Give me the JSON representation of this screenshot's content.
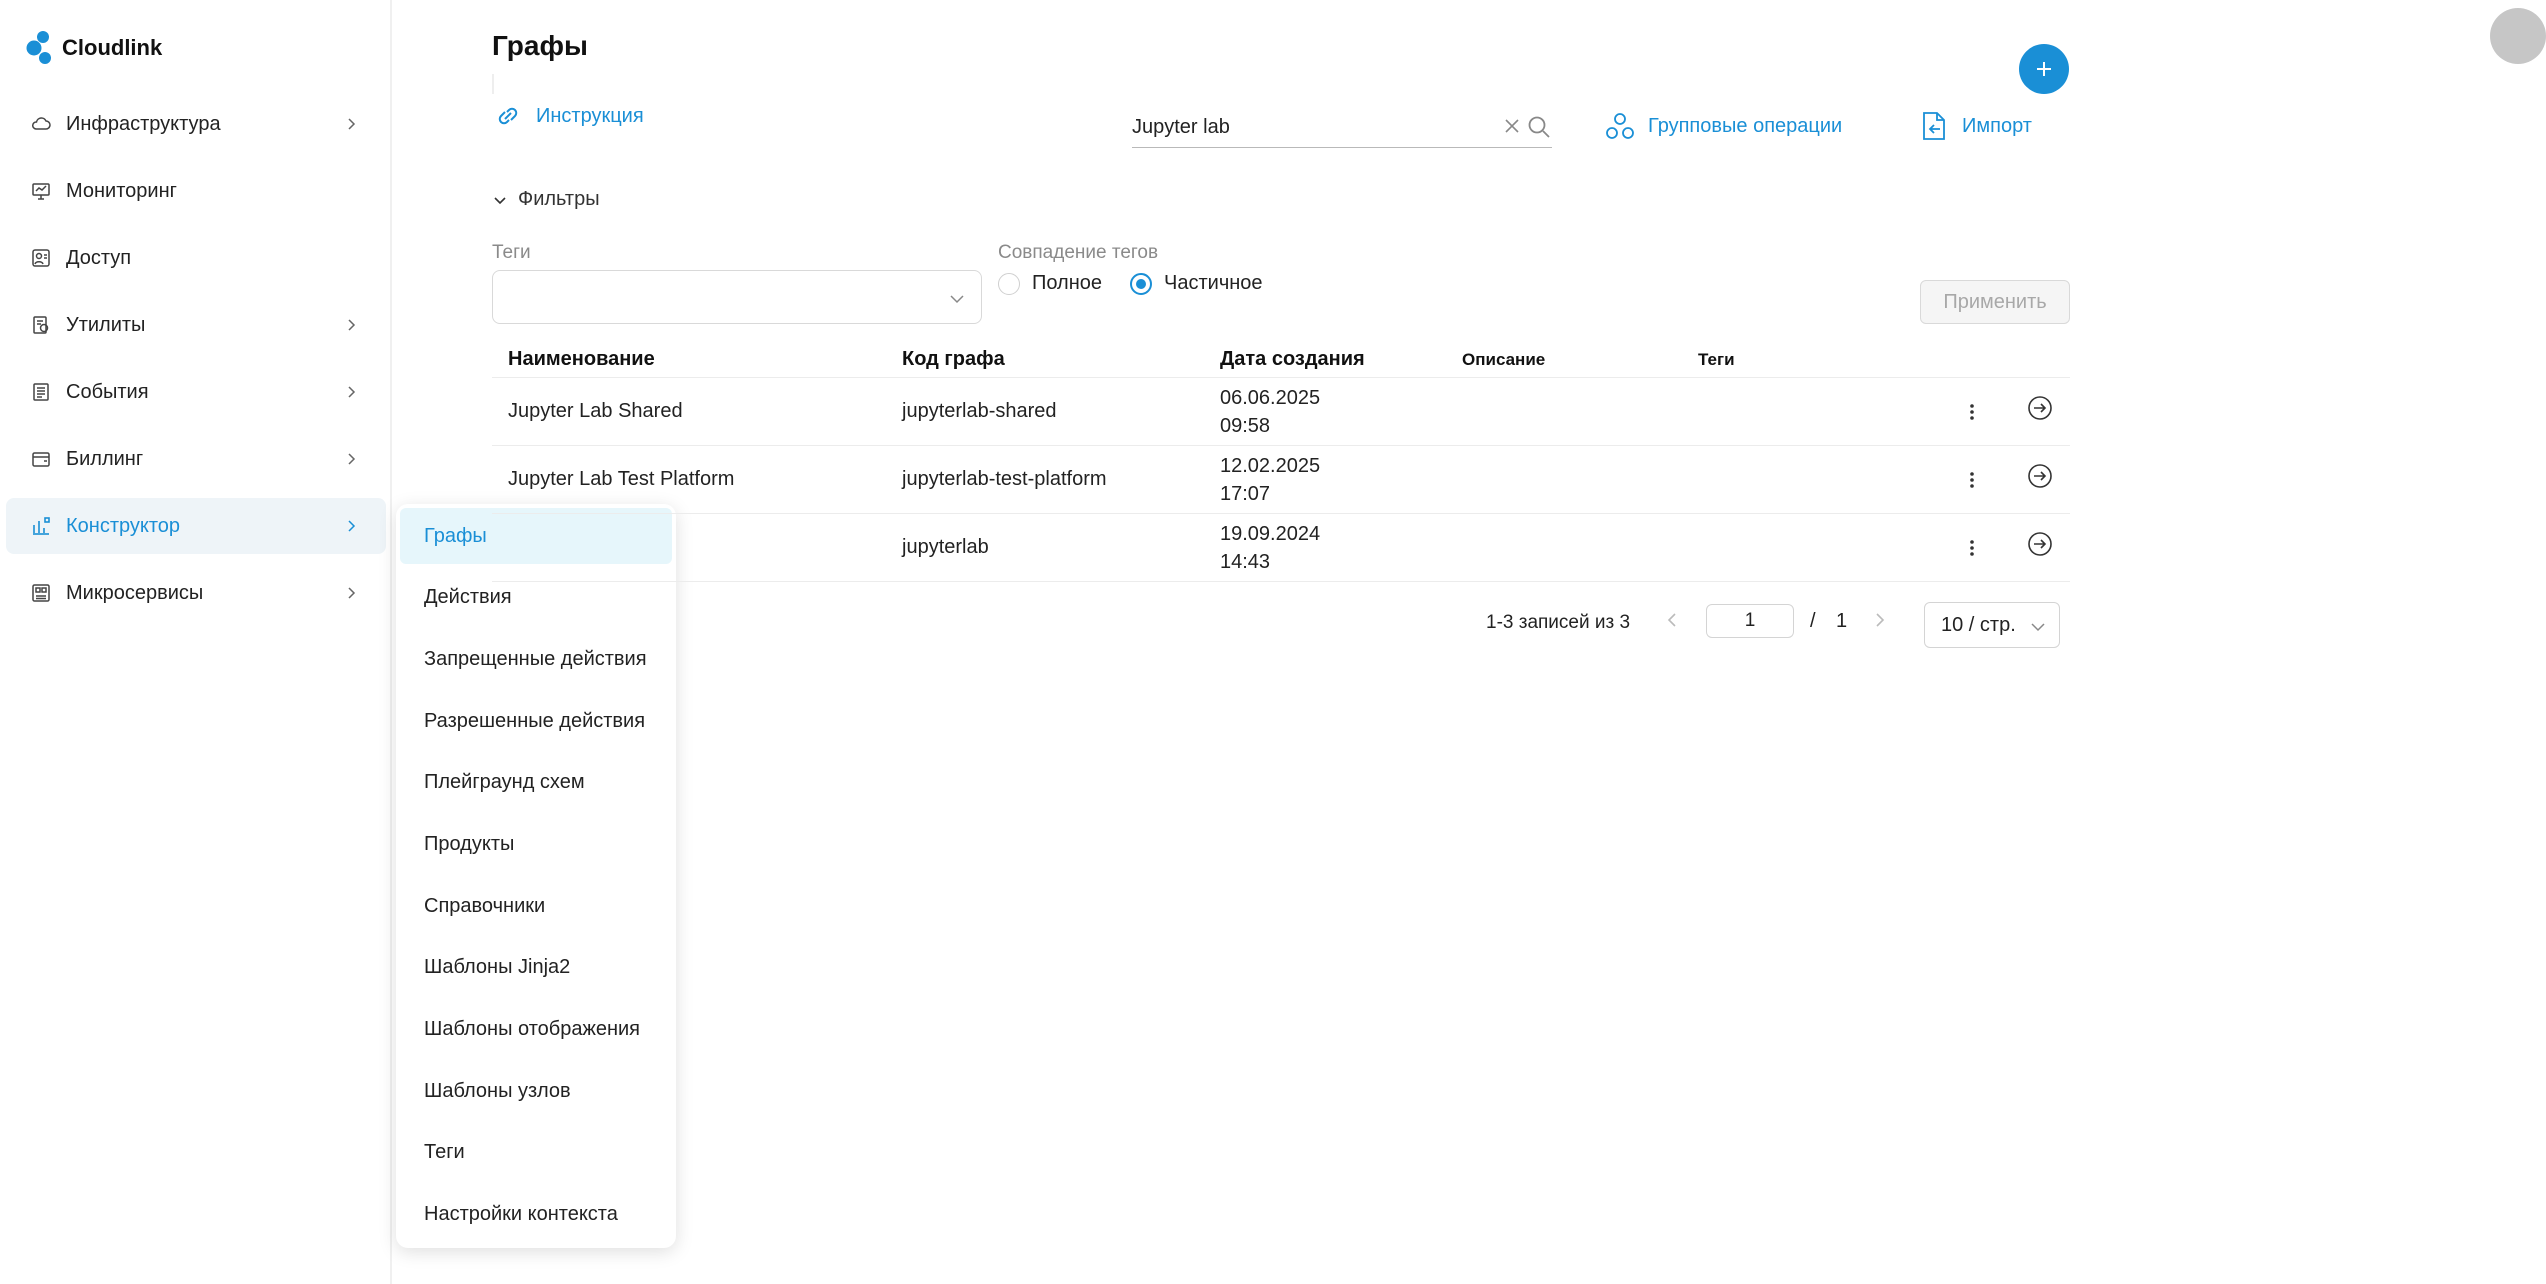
{
  "app": {
    "name": "Cloudlink",
    "brand_color": "#1a8fd6"
  },
  "sidebar": {
    "items": [
      {
        "label": "Инфраструктура",
        "icon": "cloud-icon",
        "has_children": true
      },
      {
        "label": "Мониторинг",
        "icon": "monitor-icon",
        "has_children": false
      },
      {
        "label": "Доступ",
        "icon": "user-access-icon",
        "has_children": false
      },
      {
        "label": "Утилиты",
        "icon": "tools-icon",
        "has_children": true
      },
      {
        "label": "События",
        "icon": "events-icon",
        "has_children": true
      },
      {
        "label": "Биллинг",
        "icon": "wallet-icon",
        "has_children": true
      },
      {
        "label": "Конструктор",
        "icon": "constructor-icon",
        "has_children": true,
        "active": true
      },
      {
        "label": "Микросервисы",
        "icon": "microservices-icon",
        "has_children": true
      }
    ]
  },
  "submenu": {
    "items": [
      {
        "label": "Графы",
        "active": true
      },
      {
        "label": "Действия"
      },
      {
        "label": "Запрещенные действия"
      },
      {
        "label": "Разрешенные действия"
      },
      {
        "label": "Плейграунд схем"
      },
      {
        "label": "Продукты"
      },
      {
        "label": "Справочники"
      },
      {
        "label": "Шаблоны Jinja2"
      },
      {
        "label": "Шаблоны отображения"
      },
      {
        "label": "Шаблоны узлов"
      },
      {
        "label": "Теги"
      },
      {
        "label": "Настройки контекста"
      }
    ]
  },
  "header": {
    "title": "Графы",
    "instruction_label": "Инструкция",
    "search_value": "Jupyter lab",
    "group_ops_label": "Групповые операции",
    "import_label": "Импорт"
  },
  "filters": {
    "toggle_label": "Фильтры",
    "tags_label": "Теги",
    "match_label": "Совпадение тегов",
    "match_options": [
      {
        "label": "Полное",
        "checked": false
      },
      {
        "label": "Частичное",
        "checked": true
      }
    ],
    "apply_label": "Применить"
  },
  "table": {
    "columns": [
      "Наименование",
      "Код графа",
      "Дата создания",
      "Описание",
      "Теги"
    ],
    "rows": [
      {
        "name": "Jupyter Lab Shared",
        "code": "jupyterlab-shared",
        "date": "06.06.2025",
        "time": "09:58",
        "description": "",
        "tags": ""
      },
      {
        "name": "Jupyter Lab Test Platform",
        "code": "jupyterlab-test-platform",
        "date": "12.02.2025",
        "time": "17:07",
        "description": "",
        "tags": ""
      },
      {
        "name": "",
        "code": "jupyterlab",
        "date": "19.09.2024",
        "time": "14:43",
        "description": "",
        "tags": ""
      }
    ]
  },
  "pagination": {
    "info": "1-3 записей из 3",
    "current_page": "1",
    "separator": "/",
    "total_pages": "1",
    "page_size": "10 / стр."
  }
}
